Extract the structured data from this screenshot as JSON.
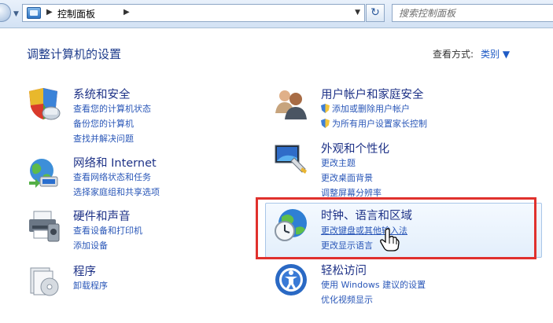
{
  "address_bar": {
    "crumb": "控制面板",
    "search_placeholder": "搜索控制面板"
  },
  "header": {
    "title": "调整计算机的设置",
    "view_by_label": "查看方式:",
    "view_by_value": "类别 ▼"
  },
  "categories": [
    {
      "title": "系统和安全",
      "links": [
        "查看您的计算机状态",
        "备份您的计算机",
        "查找并解决问题"
      ],
      "icon": "system-security-icon"
    },
    {
      "title": "网络和 Internet",
      "links": [
        "查看网络状态和任务",
        "选择家庭组和共享选项"
      ],
      "icon": "network-icon"
    },
    {
      "title": "硬件和声音",
      "links": [
        "查看设备和打印机",
        "添加设备"
      ],
      "icon": "hardware-sound-icon"
    },
    {
      "title": "程序",
      "links": [
        "卸载程序"
      ],
      "icon": "programs-icon"
    },
    {
      "title": "用户帐户和家庭安全",
      "links": [
        "添加或删除用户帐户",
        "为所有用户设置家长控制"
      ],
      "icon": "user-accounts-icon"
    },
    {
      "title": "外观和个性化",
      "links": [
        "更改主题",
        "更改桌面背景",
        "调整屏幕分辨率"
      ],
      "icon": "appearance-icon"
    },
    {
      "title": "时钟、语言和区域",
      "links": [
        "更改键盘或其他输入法",
        "更改显示语言"
      ],
      "icon": "clock-language-region-icon"
    },
    {
      "title": "轻松访问",
      "links": [
        "使用 Windows 建议的设置",
        "优化视频显示"
      ],
      "icon": "ease-of-access-icon"
    }
  ],
  "colors": {
    "highlight_frame": "#e0312d",
    "link": "#2a57b8",
    "title": "#1e3287"
  }
}
